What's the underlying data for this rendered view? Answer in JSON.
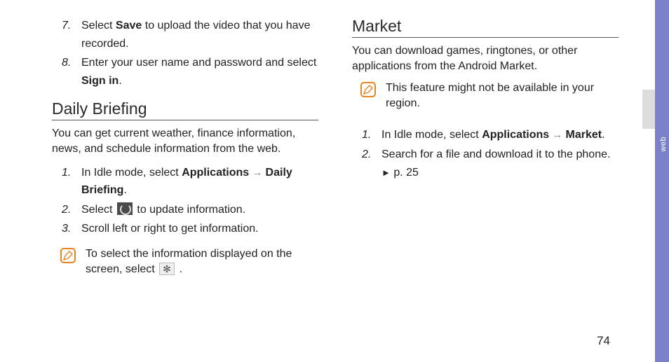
{
  "page_number": "74",
  "side_tab": "web",
  "left": {
    "list_top": [
      {
        "pre": "Select ",
        "bold": "Save",
        "post": " to upload the video that you have recorded."
      },
      {
        "pre": "Enter your user name and password and select ",
        "bold": "Sign in",
        "post": "."
      }
    ],
    "heading": "Daily Briefing",
    "intro": "You can get current weather, finance information, news, and schedule information from the web.",
    "steps": {
      "s1_pre": "In Idle mode, select ",
      "s1_b1": "Applications",
      "s1_arrow": " → ",
      "s1_b2": "Daily Briefing",
      "s1_post": ".",
      "s2_pre": "Select ",
      "s2_post": " to update information.",
      "s3": "Scroll left or right to get information."
    },
    "note_pre": "To select the information displayed on the screen, select ",
    "note_post": " ."
  },
  "right": {
    "heading": "Market",
    "intro": "You can download games, ringtones, or other applications from the Android Market.",
    "note": "This feature might not be available in your region.",
    "steps": {
      "s1_pre": "In Idle mode, select ",
      "s1_b1": "Applications",
      "s1_arrow": " → ",
      "s1_b2": "Market",
      "s1_post": ".",
      "s2_pre": "Search for a file and download it to the phone. ",
      "s2_tri": "►",
      "s2_post": " p. 25"
    }
  }
}
